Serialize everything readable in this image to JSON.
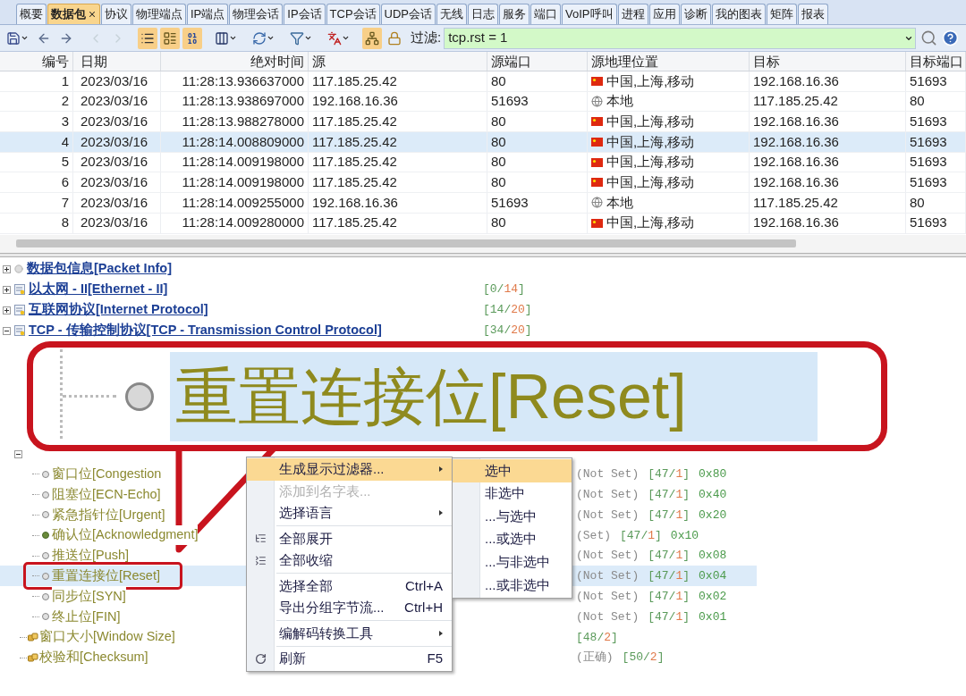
{
  "tabs": [
    {
      "label": "概要",
      "selected": false
    },
    {
      "label": "数据包",
      "selected": true,
      "closable": true
    },
    {
      "label": "协议",
      "selected": false
    },
    {
      "label": "物理端点",
      "selected": false
    },
    {
      "label": "IP端点",
      "selected": false
    },
    {
      "label": "物理会话",
      "selected": false
    },
    {
      "label": "IP会话",
      "selected": false
    },
    {
      "label": "TCP会话",
      "selected": false
    },
    {
      "label": "UDP会话",
      "selected": false
    },
    {
      "label": "无线",
      "selected": false
    },
    {
      "label": "日志",
      "selected": false
    },
    {
      "label": "服务",
      "selected": false
    },
    {
      "label": "端口",
      "selected": false
    },
    {
      "label": "VoIP呼叫",
      "selected": false
    },
    {
      "label": "进程",
      "selected": false
    },
    {
      "label": "应用",
      "selected": false
    },
    {
      "label": "诊断",
      "selected": false
    },
    {
      "label": "我的图表",
      "selected": false
    },
    {
      "label": "矩阵",
      "selected": false
    },
    {
      "label": "报表",
      "selected": false
    }
  ],
  "toolbar": {
    "buttons": [
      {
        "kind": "save",
        "dropdown": true,
        "active": false,
        "disabled": false
      },
      {
        "kind": "back",
        "dropdown": false,
        "active": false,
        "disabled": false
      },
      {
        "kind": "forward",
        "dropdown": false,
        "active": false,
        "disabled": false
      },
      {
        "kind": "bookmark-prev",
        "dropdown": false,
        "active": false,
        "disabled": true
      },
      {
        "kind": "bookmark-next",
        "dropdown": false,
        "active": false,
        "disabled": true
      },
      {
        "kind": "list",
        "dropdown": false,
        "active": true,
        "disabled": false
      },
      {
        "kind": "detail",
        "dropdown": false,
        "active": true,
        "disabled": false
      },
      {
        "kind": "hex",
        "dropdown": false,
        "active": true,
        "disabled": false
      },
      {
        "kind": "columns",
        "dropdown": true,
        "active": false,
        "disabled": false
      },
      {
        "kind": "decode",
        "dropdown": true,
        "active": false,
        "disabled": false
      },
      {
        "kind": "filter",
        "dropdown": true,
        "active": false,
        "disabled": false
      },
      {
        "kind": "translate",
        "dropdown": true,
        "active": false,
        "disabled": false
      },
      {
        "kind": "tree",
        "dropdown": false,
        "active": true,
        "disabled": false
      },
      {
        "kind": "lock",
        "dropdown": false,
        "active": false,
        "disabled": false
      }
    ],
    "filter_label": "过滤:",
    "filter_value": "tcp.rst = 1"
  },
  "table": {
    "columns": [
      "编号",
      "日期",
      "绝对时间",
      "源",
      "源端口",
      "源地理位置",
      "目标",
      "目标端口"
    ],
    "rows": [
      {
        "cells": [
          "1",
          "2023/03/16",
          "11:28:13.936637000",
          "117.185.25.42",
          "80",
          "中国,上海,移动",
          "192.168.16.36",
          "51693"
        ],
        "kind": "foreign",
        "selected": false
      },
      {
        "cells": [
          "2",
          "2023/03/16",
          "11:28:13.938697000",
          "192.168.16.36",
          "51693",
          "本地",
          "117.185.25.42",
          "80"
        ],
        "kind": "local",
        "selected": false
      },
      {
        "cells": [
          "3",
          "2023/03/16",
          "11:28:13.988278000",
          "117.185.25.42",
          "80",
          "中国,上海,移动",
          "192.168.16.36",
          "51693"
        ],
        "kind": "foreign",
        "selected": false
      },
      {
        "cells": [
          "4",
          "2023/03/16",
          "11:28:14.008809000",
          "117.185.25.42",
          "80",
          "中国,上海,移动",
          "192.168.16.36",
          "51693"
        ],
        "kind": "foreign",
        "selected": true
      },
      {
        "cells": [
          "5",
          "2023/03/16",
          "11:28:14.009198000",
          "117.185.25.42",
          "80",
          "中国,上海,移动",
          "192.168.16.36",
          "51693"
        ],
        "kind": "foreign",
        "selected": false
      },
      {
        "cells": [
          "6",
          "2023/03/16",
          "11:28:14.009198000",
          "117.185.25.42",
          "80",
          "中国,上海,移动",
          "192.168.16.36",
          "51693"
        ],
        "kind": "foreign",
        "selected": false
      },
      {
        "cells": [
          "7",
          "2023/03/16",
          "11:28:14.009255000",
          "192.168.16.36",
          "51693",
          "本地",
          "117.185.25.42",
          "80"
        ],
        "kind": "local",
        "selected": false
      },
      {
        "cells": [
          "8",
          "2023/03/16",
          "11:28:14.009280000",
          "117.185.25.42",
          "80",
          "中国,上海,移动",
          "192.168.16.36",
          "51693"
        ],
        "kind": "foreign",
        "selected": false
      }
    ]
  },
  "tree": [
    {
      "label": "数据包信息[Packet Info]",
      "expanded": false
    },
    {
      "label": "以太网 - II[Ethernet - II]",
      "expanded": false,
      "range": [
        "[0/",
        "14",
        "]"
      ]
    },
    {
      "label": "互联网协议[Internet Protocol]",
      "expanded": false,
      "range": [
        "[14/",
        "20",
        "]"
      ]
    },
    {
      "label": "TCP - 传输控制协议[TCP - Transmission Control Protocol]",
      "expanded": true,
      "range": [
        "[34/",
        "20",
        "]"
      ],
      "children": [
        {
          "kind": "group",
          "expanded": true,
          "children": [
            {
              "kind": "flag",
              "label": "窗口位[Congestion",
              "state": "(Not Set)",
              "set": false,
              "range": [
                "[47/",
                "1",
                "]"
              ],
              "hex": "0x80",
              "selected": false
            },
            {
              "kind": "flag",
              "label": "阻塞位[ECN-Echo]",
              "state": "(Not Set)",
              "set": false,
              "range": [
                "[47/",
                "1",
                "]"
              ],
              "hex": "0x40",
              "selected": false
            },
            {
              "kind": "flag",
              "label": "紧急指针位[Urgent]",
              "state": "(Not Set)",
              "set": false,
              "range": [
                "[47/",
                "1",
                "]"
              ],
              "hex": "0x20",
              "selected": false
            },
            {
              "kind": "flag",
              "label": "确认位[Acknowledgment]",
              "state": "(Set)",
              "set": true,
              "range": [
                "[47/",
                "1",
                "]"
              ],
              "hex": "0x10",
              "selected": false
            },
            {
              "kind": "flag",
              "label": "推送位[Push]",
              "state": "(Not Set)",
              "set": false,
              "range": [
                "[47/",
                "1",
                "]"
              ],
              "hex": "0x08",
              "selected": false
            },
            {
              "kind": "flag",
              "label": "重置连接位[Reset]",
              "state": "(Not Set)",
              "set": false,
              "range": [
                "[47/",
                "1",
                "]"
              ],
              "hex": "0x04",
              "selected": true
            },
            {
              "kind": "flag",
              "label": "同步位[SYN]",
              "state": "(Not Set)",
              "set": false,
              "range": [
                "[47/",
                "1",
                "]"
              ],
              "hex": "0x02",
              "selected": false
            },
            {
              "kind": "flag",
              "label": "终止位[FIN]",
              "state": "(Not Set)",
              "set": false,
              "range": [
                "[47/",
                "1",
                "]"
              ],
              "hex": "0x01",
              "selected": false
            }
          ]
        },
        {
          "kind": "field",
          "label": "窗口大小[Window Size]",
          "range": [
            "[48/",
            "2",
            "]"
          ]
        },
        {
          "kind": "field",
          "label": "校验和[Checksum]",
          "state": "(正确)",
          "range": [
            "[50/",
            "2",
            "]"
          ]
        }
      ]
    }
  ],
  "context_menu": {
    "items": [
      {
        "kind": "item",
        "label": "生成显示过滤器...",
        "submenu": true,
        "selected": true,
        "disabled": false
      },
      {
        "kind": "item",
        "label": "添加到名字表...",
        "submenu": false,
        "selected": false,
        "disabled": true
      },
      {
        "kind": "item",
        "label": "选择语言",
        "submenu": true,
        "selected": false,
        "disabled": false
      },
      {
        "kind": "separator"
      },
      {
        "kind": "item",
        "label": "全部展开",
        "submenu": false,
        "selected": false,
        "disabled": false
      },
      {
        "kind": "item",
        "label": "全部收缩",
        "submenu": false,
        "selected": false,
        "disabled": false
      },
      {
        "kind": "separator"
      },
      {
        "kind": "item",
        "label": "选择全部",
        "shortcut": "Ctrl+A",
        "submenu": false,
        "selected": false,
        "disabled": false
      },
      {
        "kind": "item",
        "label": "导出分组字节流...",
        "shortcut": "Ctrl+H",
        "submenu": false,
        "selected": false,
        "disabled": false
      },
      {
        "kind": "separator"
      },
      {
        "kind": "item",
        "label": "编解码转换工具",
        "submenu": true,
        "selected": false,
        "disabled": false
      },
      {
        "kind": "separator"
      },
      {
        "kind": "item",
        "label": "刷新",
        "shortcut": "F5",
        "submenu": false,
        "selected": false,
        "disabled": false
      }
    ],
    "submenu": [
      {
        "label": "选中",
        "selected": true
      },
      {
        "label": "非选中",
        "selected": false
      },
      {
        "label": "...与选中",
        "selected": false
      },
      {
        "label": "...或选中",
        "selected": false
      },
      {
        "label": "...与非选中",
        "selected": false
      },
      {
        "label": "...或非选中",
        "selected": false
      }
    ]
  },
  "callout": {
    "text": "重置连接位[Reset]"
  }
}
